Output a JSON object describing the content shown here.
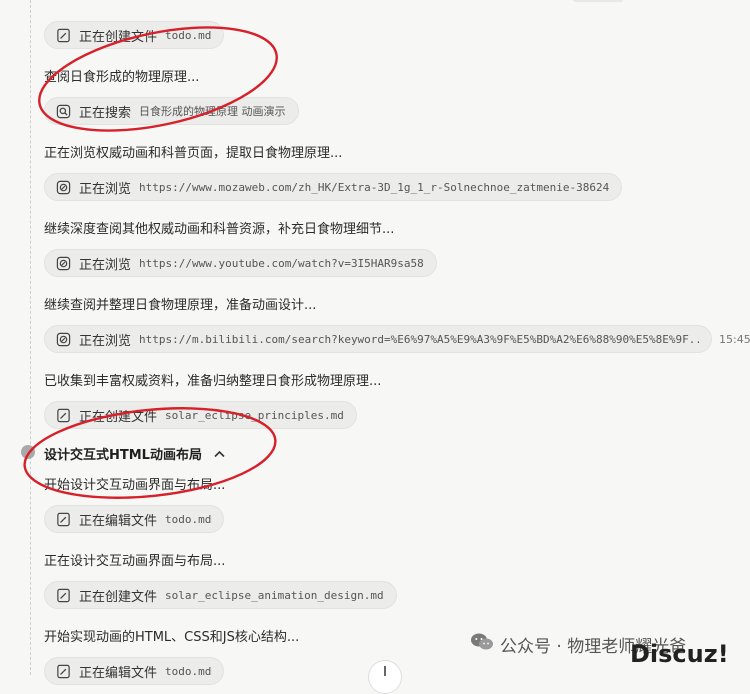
{
  "items": [
    {
      "kind": "chip",
      "icon": "edit-file-icon",
      "action": "正在创建文件",
      "detail": "todo.md"
    },
    {
      "kind": "text",
      "text": "查阅日食形成的物理原理..."
    },
    {
      "kind": "chip",
      "icon": "search-icon",
      "action": "正在搜索",
      "detail": "日食形成的物理原理 动画演示"
    },
    {
      "kind": "text",
      "text": "正在浏览权威动画和科普页面，提取日食物理原理..."
    },
    {
      "kind": "chip",
      "icon": "browser-icon",
      "action": "正在浏览",
      "detail": "https://www.mozaweb.com/zh_HK/Extra-3D_1g_1_r-Solnechnoe_zatmenie-38624"
    },
    {
      "kind": "text",
      "text": "继续深度查阅其他权威动画和科普资源，补充日食物理细节..."
    },
    {
      "kind": "chip",
      "icon": "browser-icon",
      "action": "正在浏览",
      "detail": "https://www.youtube.com/watch?v=3I5HAR9sa58"
    },
    {
      "kind": "text",
      "text": "继续查阅并整理日食物理原理，准备动画设计..."
    },
    {
      "kind": "chip",
      "icon": "browser-icon",
      "action": "正在浏览",
      "detail": "https://m.bilibili.com/search?keyword=%E6%97%A5%E9%A3%9F%E5%BD%A2%E6%88%90%E5%8E%9F...",
      "timestamp": "15:45"
    },
    {
      "kind": "text",
      "text": "已收集到丰富权威资料，准备归纳整理日食形成物理原理..."
    },
    {
      "kind": "chip",
      "icon": "edit-file-icon",
      "action": "正在创建文件",
      "detail": "solar_eclipse_principles.md"
    },
    {
      "kind": "text",
      "text": "开始设计交互动画界面与布局..."
    },
    {
      "kind": "chip",
      "icon": "edit-file-icon",
      "action": "正在编辑文件",
      "detail": "todo.md"
    },
    {
      "kind": "text",
      "text": "正在设计交互动画界面与布局..."
    },
    {
      "kind": "chip",
      "icon": "edit-file-icon",
      "action": "正在创建文件",
      "detail": "solar_eclipse_animation_design.md"
    },
    {
      "kind": "text",
      "text": "开始实现动画的HTML、CSS和JS核心结构..."
    },
    {
      "kind": "chip",
      "icon": "edit-file-icon",
      "action": "正在编辑文件",
      "detail": "todo.md"
    }
  ],
  "step": {
    "title": "设计交互式HTML动画布局"
  },
  "watermark": {
    "text": "公众号 · 物理老师耀光爸"
  },
  "discuz": "Discuz!",
  "colors": {
    "annotation": "#d6202a",
    "background": "#f7f7f6",
    "chip": "#ececeb"
  }
}
